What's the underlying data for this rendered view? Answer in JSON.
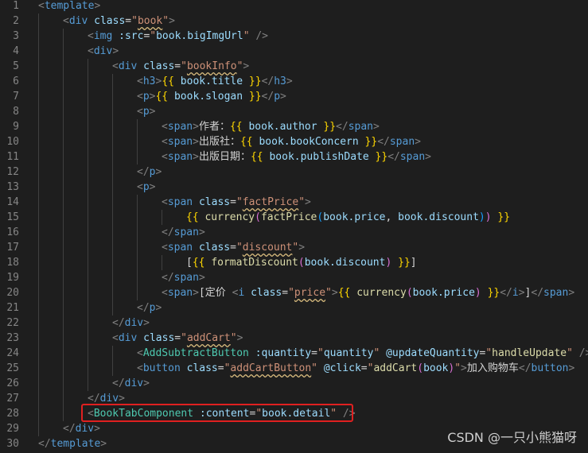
{
  "editor": {
    "lines": [
      {
        "n": "1",
        "indent": 0,
        "tokens": [
          [
            "punct",
            "<"
          ],
          [
            "tag",
            "template"
          ],
          [
            "punct",
            ">"
          ]
        ]
      },
      {
        "n": "2",
        "indent": 1,
        "tokens": [
          [
            "punct",
            "<"
          ],
          [
            "tag",
            "div "
          ],
          [
            "attr",
            "class"
          ],
          [
            "eq",
            "="
          ],
          [
            "str",
            "\""
          ],
          [
            "str-sq",
            "book"
          ],
          [
            "str",
            "\""
          ],
          [
            "punct",
            ">"
          ]
        ]
      },
      {
        "n": "3",
        "indent": 2,
        "tokens": [
          [
            "punct",
            "<"
          ],
          [
            "tag",
            "img "
          ],
          [
            "attr",
            ":src"
          ],
          [
            "eq",
            "="
          ],
          [
            "str",
            "\""
          ],
          [
            "var",
            "book.bigImgUrl"
          ],
          [
            "str",
            "\""
          ],
          [
            "txt",
            " "
          ],
          [
            "punct",
            "/>"
          ]
        ]
      },
      {
        "n": "4",
        "indent": 2,
        "tokens": [
          [
            "punct",
            "<"
          ],
          [
            "tag",
            "div"
          ],
          [
            "punct",
            ">"
          ]
        ]
      },
      {
        "n": "5",
        "indent": 3,
        "tokens": [
          [
            "punct",
            "<"
          ],
          [
            "tag",
            "div "
          ],
          [
            "attr",
            "class"
          ],
          [
            "eq",
            "="
          ],
          [
            "str",
            "\""
          ],
          [
            "str-sq",
            "bookInfo"
          ],
          [
            "str",
            "\""
          ],
          [
            "punct",
            ">"
          ]
        ]
      },
      {
        "n": "6",
        "indent": 4,
        "tokens": [
          [
            "punct",
            "<"
          ],
          [
            "tag",
            "h3"
          ],
          [
            "punct",
            ">"
          ],
          [
            "brace",
            "{{ "
          ],
          [
            "var",
            "book.title"
          ],
          [
            "brace",
            " }}"
          ],
          [
            "punct",
            "</"
          ],
          [
            "tag",
            "h3"
          ],
          [
            "punct",
            ">"
          ]
        ]
      },
      {
        "n": "7",
        "indent": 4,
        "tokens": [
          [
            "punct",
            "<"
          ],
          [
            "tag",
            "p"
          ],
          [
            "punct",
            ">"
          ],
          [
            "brace",
            "{{ "
          ],
          [
            "var",
            "book.slogan"
          ],
          [
            "brace",
            " }}"
          ],
          [
            "punct",
            "</"
          ],
          [
            "tag",
            "p"
          ],
          [
            "punct",
            ">"
          ]
        ]
      },
      {
        "n": "8",
        "indent": 4,
        "tokens": [
          [
            "punct",
            "<"
          ],
          [
            "tag",
            "p"
          ],
          [
            "punct",
            ">"
          ]
        ]
      },
      {
        "n": "9",
        "indent": 5,
        "tokens": [
          [
            "punct",
            "<"
          ],
          [
            "tag",
            "span"
          ],
          [
            "punct",
            ">"
          ],
          [
            "txt",
            "作者："
          ],
          [
            "brace",
            "{{ "
          ],
          [
            "var",
            "book.author"
          ],
          [
            "brace",
            " }}"
          ],
          [
            "punct",
            "</"
          ],
          [
            "tag",
            "span"
          ],
          [
            "punct",
            ">"
          ]
        ]
      },
      {
        "n": "10",
        "indent": 5,
        "tokens": [
          [
            "punct",
            "<"
          ],
          [
            "tag",
            "span"
          ],
          [
            "punct",
            ">"
          ],
          [
            "txt",
            "出版社："
          ],
          [
            "brace",
            "{{ "
          ],
          [
            "var",
            "book.bookConcern"
          ],
          [
            "brace",
            " }}"
          ],
          [
            "punct",
            "</"
          ],
          [
            "tag",
            "span"
          ],
          [
            "punct",
            ">"
          ]
        ]
      },
      {
        "n": "11",
        "indent": 5,
        "tokens": [
          [
            "punct",
            "<"
          ],
          [
            "tag",
            "span"
          ],
          [
            "punct",
            ">"
          ],
          [
            "txt",
            "出版日期："
          ],
          [
            "brace",
            "{{ "
          ],
          [
            "var",
            "book.publishDate"
          ],
          [
            "brace",
            " }}"
          ],
          [
            "punct",
            "</"
          ],
          [
            "tag",
            "span"
          ],
          [
            "punct",
            ">"
          ]
        ]
      },
      {
        "n": "12",
        "indent": 4,
        "tokens": [
          [
            "punct",
            "</"
          ],
          [
            "tag",
            "p"
          ],
          [
            "punct",
            ">"
          ]
        ]
      },
      {
        "n": "13",
        "indent": 4,
        "tokens": [
          [
            "punct",
            "<"
          ],
          [
            "tag",
            "p"
          ],
          [
            "punct",
            ">"
          ]
        ]
      },
      {
        "n": "14",
        "indent": 5,
        "tokens": [
          [
            "punct",
            "<"
          ],
          [
            "tag",
            "span "
          ],
          [
            "attr",
            "class"
          ],
          [
            "eq",
            "="
          ],
          [
            "str",
            "\""
          ],
          [
            "str-sq",
            "factPrice"
          ],
          [
            "str",
            "\""
          ],
          [
            "punct",
            ">"
          ]
        ]
      },
      {
        "n": "15",
        "indent": 6,
        "tokens": [
          [
            "brace",
            "{{ "
          ],
          [
            "fn",
            "currency"
          ],
          [
            "paren",
            "("
          ],
          [
            "fn",
            "factPrice"
          ],
          [
            "paren2",
            "("
          ],
          [
            "var",
            "book.price"
          ],
          [
            "txt",
            ", "
          ],
          [
            "var",
            "book.discount"
          ],
          [
            "paren2",
            ")"
          ],
          [
            "paren",
            ")"
          ],
          [
            "brace",
            " }}"
          ]
        ]
      },
      {
        "n": "16",
        "indent": 5,
        "tokens": [
          [
            "punct",
            "</"
          ],
          [
            "tag",
            "span"
          ],
          [
            "punct",
            ">"
          ]
        ]
      },
      {
        "n": "17",
        "indent": 5,
        "tokens": [
          [
            "punct",
            "<"
          ],
          [
            "tag",
            "span "
          ],
          [
            "attr",
            "class"
          ],
          [
            "eq",
            "="
          ],
          [
            "str",
            "\""
          ],
          [
            "str-sq",
            "discount"
          ],
          [
            "str",
            "\""
          ],
          [
            "punct",
            ">"
          ]
        ]
      },
      {
        "n": "18",
        "indent": 6,
        "tokens": [
          [
            "txt",
            "["
          ],
          [
            "brace",
            "{{ "
          ],
          [
            "fn",
            "formatDiscount"
          ],
          [
            "paren",
            "("
          ],
          [
            "var",
            "book.discount"
          ],
          [
            "paren",
            ")"
          ],
          [
            "brace",
            " }}"
          ],
          [
            "txt",
            "]"
          ]
        ]
      },
      {
        "n": "19",
        "indent": 5,
        "tokens": [
          [
            "punct",
            "</"
          ],
          [
            "tag",
            "span"
          ],
          [
            "punct",
            ">"
          ]
        ]
      },
      {
        "n": "20",
        "indent": 5,
        "tokens": [
          [
            "punct",
            "<"
          ],
          [
            "tag",
            "span"
          ],
          [
            "punct",
            ">"
          ],
          [
            "txt",
            "[定价 "
          ],
          [
            "punct",
            "<"
          ],
          [
            "tag",
            "i "
          ],
          [
            "attr",
            "class"
          ],
          [
            "eq",
            "="
          ],
          [
            "str",
            "\""
          ],
          [
            "str-sq",
            "price"
          ],
          [
            "str",
            "\""
          ],
          [
            "punct",
            ">"
          ],
          [
            "brace",
            "{{ "
          ],
          [
            "fn",
            "currency"
          ],
          [
            "paren",
            "("
          ],
          [
            "var",
            "book.price"
          ],
          [
            "paren",
            ")"
          ],
          [
            "brace",
            " }}"
          ],
          [
            "punct",
            "</"
          ],
          [
            "tag",
            "i"
          ],
          [
            "punct",
            ">"
          ],
          [
            "txt",
            "]"
          ],
          [
            "punct",
            "</"
          ],
          [
            "tag",
            "span"
          ],
          [
            "punct",
            ">"
          ]
        ]
      },
      {
        "n": "21",
        "indent": 4,
        "tokens": [
          [
            "punct",
            "</"
          ],
          [
            "tag",
            "p"
          ],
          [
            "punct",
            ">"
          ]
        ]
      },
      {
        "n": "22",
        "indent": 3,
        "tokens": [
          [
            "punct",
            "</"
          ],
          [
            "tag",
            "div"
          ],
          [
            "punct",
            ">"
          ]
        ]
      },
      {
        "n": "23",
        "indent": 3,
        "tokens": [
          [
            "punct",
            "<"
          ],
          [
            "tag",
            "div "
          ],
          [
            "attr",
            "class"
          ],
          [
            "eq",
            "="
          ],
          [
            "str",
            "\""
          ],
          [
            "str-sq",
            "addCart"
          ],
          [
            "str",
            "\""
          ],
          [
            "punct",
            ">"
          ]
        ]
      },
      {
        "n": "24",
        "indent": 4,
        "tokens": [
          [
            "punct",
            "<"
          ],
          [
            "comp",
            "AddSubtractButton "
          ],
          [
            "attr",
            ":quantity"
          ],
          [
            "eq",
            "="
          ],
          [
            "str",
            "\""
          ],
          [
            "var",
            "quantity"
          ],
          [
            "str",
            "\" "
          ],
          [
            "attr",
            "@updateQuantity"
          ],
          [
            "eq",
            "="
          ],
          [
            "str",
            "\""
          ],
          [
            "fn",
            "handleUpdate"
          ],
          [
            "str",
            "\""
          ],
          [
            "txt",
            " "
          ],
          [
            "punct",
            "/>"
          ]
        ]
      },
      {
        "n": "25",
        "indent": 4,
        "tokens": [
          [
            "punct",
            "<"
          ],
          [
            "tag",
            "button "
          ],
          [
            "attr",
            "class"
          ],
          [
            "eq",
            "="
          ],
          [
            "str",
            "\""
          ],
          [
            "str-sq",
            "addCartButton"
          ],
          [
            "str",
            "\" "
          ],
          [
            "attr",
            "@click"
          ],
          [
            "eq",
            "="
          ],
          [
            "str",
            "\""
          ],
          [
            "fn",
            "addCart"
          ],
          [
            "paren",
            "("
          ],
          [
            "var",
            "book"
          ],
          [
            "paren",
            ")"
          ],
          [
            "str",
            "\""
          ],
          [
            "punct",
            ">"
          ],
          [
            "txt",
            "加入购物车"
          ],
          [
            "punct",
            "</"
          ],
          [
            "tag",
            "button"
          ],
          [
            "punct",
            ">"
          ]
        ]
      },
      {
        "n": "26",
        "indent": 3,
        "tokens": [
          [
            "punct",
            "</"
          ],
          [
            "tag",
            "div"
          ],
          [
            "punct",
            ">"
          ]
        ]
      },
      {
        "n": "27",
        "indent": 2,
        "tokens": [
          [
            "punct",
            "</"
          ],
          [
            "tag",
            "div"
          ],
          [
            "punct",
            ">"
          ]
        ]
      },
      {
        "n": "28",
        "indent": 2,
        "tokens": [
          [
            "punct",
            "<"
          ],
          [
            "comp",
            "BookTabComponent "
          ],
          [
            "attr",
            ":content"
          ],
          [
            "eq",
            "="
          ],
          [
            "str",
            "\""
          ],
          [
            "var",
            "book.detail"
          ],
          [
            "str",
            "\""
          ],
          [
            "txt",
            " "
          ],
          [
            "punct",
            "/>"
          ]
        ]
      },
      {
        "n": "29",
        "indent": 1,
        "tokens": [
          [
            "punct",
            "</"
          ],
          [
            "tag",
            "div"
          ],
          [
            "punct",
            ">"
          ]
        ]
      },
      {
        "n": "30",
        "indent": 0,
        "tokens": [
          [
            "punct",
            "</"
          ],
          [
            "tag",
            "template"
          ],
          [
            "punct",
            ">"
          ]
        ]
      }
    ]
  },
  "watermark": {
    "text": "CSDN @一只小熊猫呀"
  },
  "colors": {
    "highlight": "#e02020",
    "background": "#1e1e1e"
  }
}
